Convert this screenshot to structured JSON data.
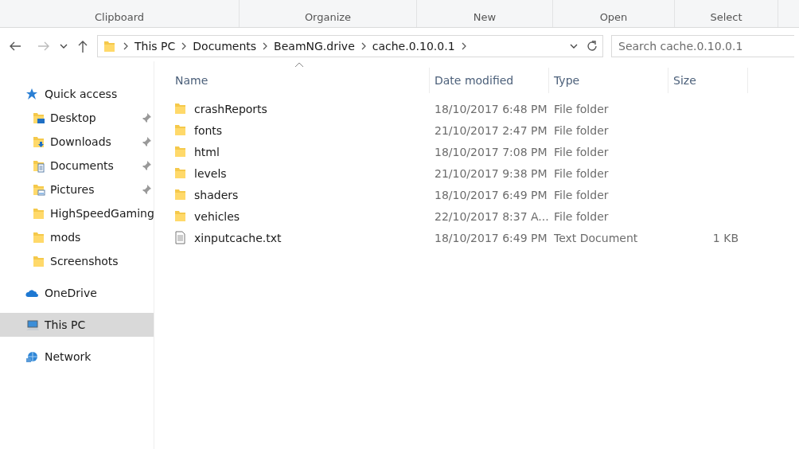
{
  "ribbon": {
    "groups": [
      "Clipboard",
      "Organize",
      "New",
      "Open",
      "Select"
    ]
  },
  "address_bar": {
    "crumbs": [
      "This PC",
      "Documents",
      "BeamNG.drive",
      "cache.0.10.0.1"
    ]
  },
  "search": {
    "placeholder": "Search cache.0.10.0.1"
  },
  "sidebar": {
    "items": [
      {
        "label": "Quick access",
        "kind": "star",
        "selected": false,
        "children": [
          {
            "label": "Desktop",
            "kind": "desktop",
            "pinned": true,
            "selected": false
          },
          {
            "label": "Downloads",
            "kind": "downloads",
            "pinned": true,
            "selected": false
          },
          {
            "label": "Documents",
            "kind": "documents",
            "pinned": true,
            "selected": false
          },
          {
            "label": "Pictures",
            "kind": "pictures",
            "pinned": true,
            "selected": false
          },
          {
            "label": "HighSpeedGaming",
            "kind": "folder",
            "pinned": false,
            "selected": false
          },
          {
            "label": "mods",
            "kind": "folder",
            "pinned": false,
            "selected": false
          },
          {
            "label": "Screenshots",
            "kind": "folder",
            "pinned": false,
            "selected": false
          }
        ]
      },
      {
        "label": "OneDrive",
        "kind": "cloud",
        "selected": false
      },
      {
        "label": "This PC",
        "kind": "pc",
        "selected": true
      },
      {
        "label": "Network",
        "kind": "network",
        "selected": false
      }
    ]
  },
  "table": {
    "columns": [
      "Name",
      "Date modified",
      "Type",
      "Size"
    ],
    "rows": [
      {
        "name": "crashReports",
        "kind": "folder",
        "date": "18/10/2017 6:48 PM",
        "type": "File folder"
      },
      {
        "name": "fonts",
        "kind": "folder",
        "date": "21/10/2017 2:47 PM",
        "type": "File folder"
      },
      {
        "name": "html",
        "kind": "folder",
        "date": "18/10/2017 7:08 PM",
        "type": "File folder"
      },
      {
        "name": "levels",
        "kind": "folder",
        "date": "21/10/2017 9:38 PM",
        "type": "File folder"
      },
      {
        "name": "shaders",
        "kind": "folder",
        "date": "18/10/2017 6:49 PM",
        "type": "File folder"
      },
      {
        "name": "vehicles",
        "kind": "folder",
        "date": "22/10/2017 8:37 A...",
        "type": "File folder"
      },
      {
        "name": "xinputcache.txt",
        "kind": "text",
        "date": "18/10/2017 6:49 PM",
        "type": "Text Document",
        "size": "1 KB"
      }
    ]
  }
}
